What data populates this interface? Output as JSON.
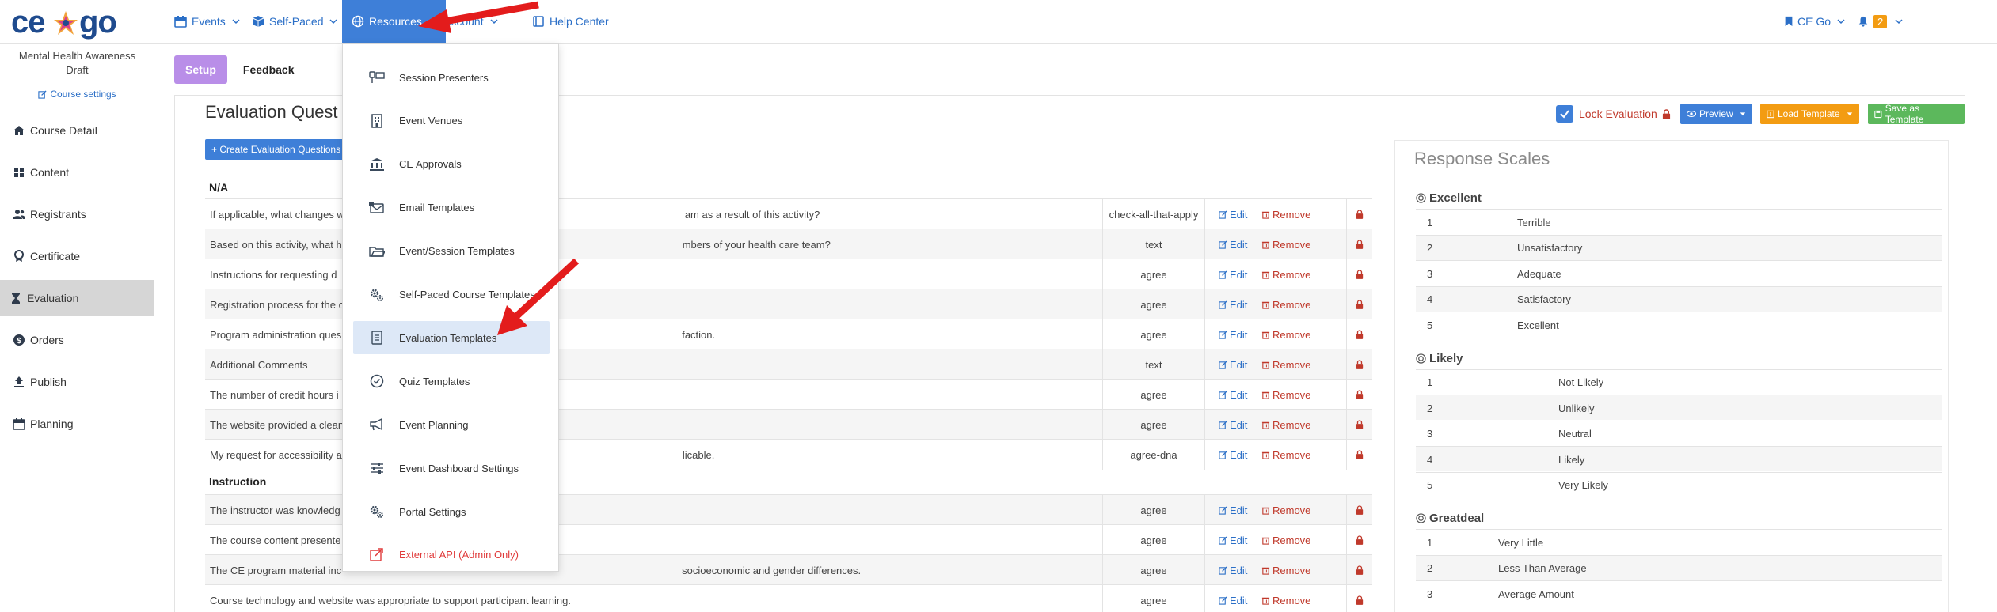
{
  "brand": {
    "logo_left": "ce",
    "logo_right": "go"
  },
  "nav": {
    "events": "Events",
    "self_paced": "Self-Paced",
    "resources": "Resources",
    "account": "Account",
    "help_center": "Help Center",
    "ce_go": "CE Go",
    "notifications_count": "2"
  },
  "sidebar": {
    "course_name": "Mental Health Awareness Draft",
    "course_settings": "Course settings",
    "items": [
      {
        "label": "Course Detail",
        "icon": "home-icon"
      },
      {
        "label": "Content",
        "icon": "grid-icon"
      },
      {
        "label": "Registrants",
        "icon": "users-icon"
      },
      {
        "label": "Certificate",
        "icon": "award-icon"
      },
      {
        "label": "Evaluation",
        "icon": "hourglass-icon",
        "active": true
      },
      {
        "label": "Orders",
        "icon": "dollar-icon"
      },
      {
        "label": "Publish",
        "icon": "upload-icon"
      },
      {
        "label": "Planning",
        "icon": "calendar-icon"
      }
    ]
  },
  "tabs": {
    "setup": "Setup",
    "feedback": "Feedback"
  },
  "main": {
    "title": "Evaluation Quest",
    "create_button": "+ Create Evaluation Questions",
    "lock_evaluation": "Lock Evaluation",
    "preview": "Preview",
    "load_template": "Load Template",
    "save_as_template": "Save as Template",
    "edit_label": "Edit",
    "remove_label": "Remove",
    "sections": [
      {
        "name": "N/A",
        "questions": [
          {
            "text": "If applicable, what changes w",
            "tail": "am as a result of this activity?",
            "type": "check-all-that-apply"
          },
          {
            "text": "Based on this activity, what h",
            "tail": "mbers of your health care team?",
            "type": "text"
          },
          {
            "text": "Instructions for requesting d",
            "tail": "",
            "type": "agree"
          },
          {
            "text": "Registration process for the c",
            "tail": "",
            "type": "agree"
          },
          {
            "text": "Program administration ques",
            "tail": "faction.",
            "type": "agree"
          },
          {
            "text": "Additional Comments",
            "tail": "",
            "type": "text"
          },
          {
            "text": "The number of credit hours i",
            "tail": "",
            "type": "agree"
          },
          {
            "text": "The website provided a clean",
            "tail": "",
            "type": "agree"
          },
          {
            "text": "My request for accessibility a",
            "tail": "licable.",
            "type": "agree-dna"
          }
        ]
      },
      {
        "name": "Instruction",
        "questions": [
          {
            "text": "The instructor was knowledg",
            "tail": "",
            "type": "agree"
          },
          {
            "text": "The course content presente",
            "tail": "",
            "type": "agree"
          },
          {
            "text": "The CE program material inc",
            "tail": "socioeconomic and gender differences.",
            "type": "agree"
          },
          {
            "text": "Course technology and website was appropriate to support participant learning.",
            "tail": "",
            "type": "agree"
          }
        ]
      }
    ]
  },
  "scales": {
    "title": "Response Scales",
    "groups": [
      {
        "name": "Excellent",
        "labels": [
          "Terrible",
          "Unsatisfactory",
          "Adequate",
          "Satisfactory",
          "Excellent"
        ]
      },
      {
        "name": "Likely",
        "labels": [
          "Not Likely",
          "Unlikely",
          "Neutral",
          "Likely",
          "Very Likely"
        ]
      },
      {
        "name": "Greatdeal",
        "labels": [
          "Very Little",
          "Less Than Average",
          "Average Amount"
        ]
      }
    ],
    "numbers": [
      "1",
      "2",
      "3",
      "4",
      "5"
    ]
  },
  "dropdown": {
    "items": [
      {
        "label": "Session Presenters",
        "icon": "presenter-icon"
      },
      {
        "label": "Event Venues",
        "icon": "building-icon"
      },
      {
        "label": "CE Approvals",
        "icon": "bank-icon"
      },
      {
        "label": "Email Templates",
        "icon": "mail-icon"
      },
      {
        "label": "Event/Session Templates",
        "icon": "folder-open-icon"
      },
      {
        "label": "Self-Paced Course Templates",
        "icon": "cogs-icon"
      },
      {
        "label": "Evaluation Templates",
        "icon": "list-icon",
        "highlight": true
      },
      {
        "label": "Quiz Templates",
        "icon": "check-circle-icon"
      },
      {
        "label": "Event Planning",
        "icon": "megaphone-icon"
      },
      {
        "label": "Event Dashboard Settings",
        "icon": "sliders-icon"
      },
      {
        "label": "Portal Settings",
        "icon": "cogs-icon"
      },
      {
        "label": "External API (Admin Only)",
        "icon": "external-link-icon",
        "danger": true
      }
    ]
  },
  "colors": {
    "primary": "#3e7fd8",
    "setup_tab": "#b98ee8",
    "load_template": "#f39c12",
    "save_template": "#5cb85c",
    "danger": "#c0392b",
    "arrow": "#e31c1c"
  }
}
